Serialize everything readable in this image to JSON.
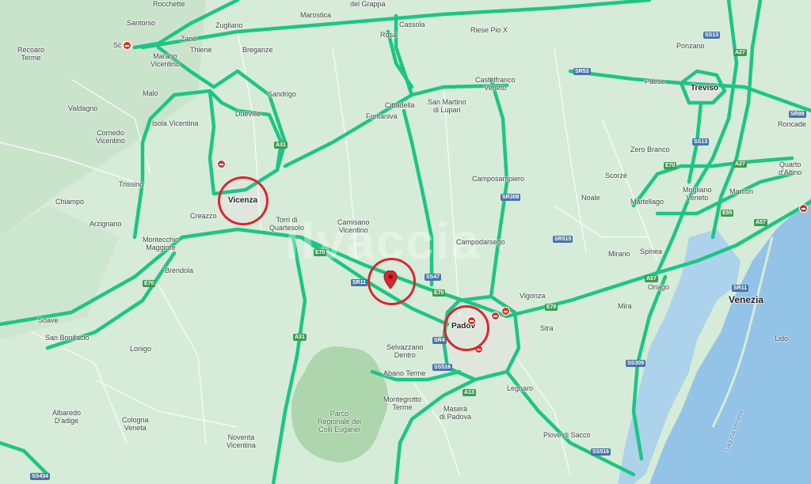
{
  "map": {
    "cities": [
      {
        "id": "rocchette",
        "name": "Rocchette"
      },
      {
        "id": "santorso",
        "name": "Santorso"
      },
      {
        "id": "schio",
        "name": "Sc"
      },
      {
        "id": "recoaro",
        "name": "Recoaro\nTerme"
      },
      {
        "id": "zane",
        "name": "Zanè"
      },
      {
        "id": "zugliano",
        "name": "Zugliano"
      },
      {
        "id": "marostica",
        "name": "Marostica"
      },
      {
        "id": "bassano",
        "name": "del Grappa"
      },
      {
        "id": "cassola",
        "name": "Cassola"
      },
      {
        "id": "rosa",
        "name": "Rosà"
      },
      {
        "id": "riese",
        "name": "Riese Pio X"
      },
      {
        "id": "marano",
        "name": "Marano\nVicentino"
      },
      {
        "id": "thiene",
        "name": "Thiene"
      },
      {
        "id": "breganze",
        "name": "Breganze"
      },
      {
        "id": "malo",
        "name": "Malo"
      },
      {
        "id": "valdagno",
        "name": "Valdagno"
      },
      {
        "id": "sandrigo",
        "name": "Sandrigo"
      },
      {
        "id": "cittadella",
        "name": "Cittadella"
      },
      {
        "id": "sanmartino",
        "name": "San Martino\ndi Lupari"
      },
      {
        "id": "castelfranco",
        "name": "Castelfranco\nVeneto"
      },
      {
        "id": "paese",
        "name": "Paese"
      },
      {
        "id": "ponzano",
        "name": "Ponzano"
      },
      {
        "id": "isola",
        "name": "Isola Vicentina"
      },
      {
        "id": "dueville",
        "name": "Dueville"
      },
      {
        "id": "fontaniva",
        "name": "Fontaniva"
      },
      {
        "id": "cornedo",
        "name": "Cornedo\nVicentino"
      },
      {
        "id": "trissino",
        "name": "Trissino"
      },
      {
        "id": "vicenza",
        "name": "Vicenza",
        "big": true
      },
      {
        "id": "chiampo",
        "name": "Chiampo"
      },
      {
        "id": "arzignano",
        "name": "Arzignano"
      },
      {
        "id": "creazzo",
        "name": "Creazzo"
      },
      {
        "id": "torri",
        "name": "Torri di\nQuartesolo"
      },
      {
        "id": "camisano",
        "name": "Camisano\nVicentino"
      },
      {
        "id": "camposampiero",
        "name": "Camposampiero"
      },
      {
        "id": "noale",
        "name": "Noale"
      },
      {
        "id": "scorze",
        "name": "Scorzè"
      },
      {
        "id": "zerobranco",
        "name": "Zero Branco"
      },
      {
        "id": "treviso",
        "name": "Treviso",
        "big": true
      },
      {
        "id": "roncade",
        "name": "Roncade"
      },
      {
        "id": "quarto",
        "name": "Quarto\nd'Altino"
      },
      {
        "id": "marcon",
        "name": "Marcon"
      },
      {
        "id": "mogliano",
        "name": "Mogliano\nVeneto"
      },
      {
        "id": "martellago",
        "name": "Martellago"
      },
      {
        "id": "montecchio",
        "name": "Montecchio\nMaggiore"
      },
      {
        "id": "brendola",
        "name": "Brendola"
      },
      {
        "id": "campodarsego",
        "name": "Campodarsego"
      },
      {
        "id": "mirano",
        "name": "Mirano"
      },
      {
        "id": "spinea",
        "name": "Spinea"
      },
      {
        "id": "vigonza",
        "name": "Vigonza"
      },
      {
        "id": "padova",
        "name": "Padov",
        "big": true
      },
      {
        "id": "mira",
        "name": "Mira"
      },
      {
        "id": "oriago",
        "name": "Oriago"
      },
      {
        "id": "venezia",
        "name": "Venezia",
        "venezia": true
      },
      {
        "id": "stra",
        "name": "Stra"
      },
      {
        "id": "soave",
        "name": "Soave"
      },
      {
        "id": "sanbonifacio",
        "name": "San Bonifacio"
      },
      {
        "id": "lonigo",
        "name": "Lonigo"
      },
      {
        "id": "selvazzano",
        "name": "Selvazzano\nDentro"
      },
      {
        "id": "abano",
        "name": "Abano Terme"
      },
      {
        "id": "lido",
        "name": "Lido"
      },
      {
        "id": "montegrotto",
        "name": "Montegrotto\nTerme"
      },
      {
        "id": "legnaro",
        "name": "Legnaro"
      },
      {
        "id": "albaredo",
        "name": "Albaredo\nD'adige"
      },
      {
        "id": "cologna",
        "name": "Cologna\nVeneta"
      },
      {
        "id": "masera",
        "name": "Maserà\ndi Padova"
      },
      {
        "id": "noventa",
        "name": "Noventa\nVicentina"
      },
      {
        "id": "piove",
        "name": "Piove di Sacco"
      }
    ],
    "park_label": "Parco\nRegionale dei\nColli Euganei",
    "laguna_label": "Laguna Veneta",
    "road_shields": [
      {
        "id": "ss13a",
        "text": "SS13",
        "color": "blue"
      },
      {
        "id": "a27a",
        "text": "A27",
        "color": "green"
      },
      {
        "id": "sr53",
        "text": "SR53",
        "color": "blue"
      },
      {
        "id": "sr89",
        "text": "SR89",
        "color": "blue"
      },
      {
        "id": "a31a",
        "text": "A31",
        "color": "green"
      },
      {
        "id": "ss13b",
        "text": "SS13",
        "color": "blue"
      },
      {
        "id": "e70a",
        "text": "E70",
        "color": "green"
      },
      {
        "id": "a27b",
        "text": "A27",
        "color": "green"
      },
      {
        "id": "e55",
        "text": "E55",
        "color": "green"
      },
      {
        "id": "a57a",
        "text": "A57",
        "color": "green"
      },
      {
        "id": "sr308",
        "text": "SR308",
        "color": "blue"
      },
      {
        "id": "sr515",
        "text": "SR515",
        "color": "blue"
      },
      {
        "id": "e70b",
        "text": "E70",
        "color": "green"
      },
      {
        "id": "sr11a",
        "text": "SR11",
        "color": "blue"
      },
      {
        "id": "ss47",
        "text": "SS47",
        "color": "blue"
      },
      {
        "id": "e70c",
        "text": "E70",
        "color": "green"
      },
      {
        "id": "a57b",
        "text": "A57",
        "color": "green"
      },
      {
        "id": "e70d",
        "text": "E70",
        "color": "green"
      },
      {
        "id": "sr11b",
        "text": "SR11",
        "color": "blue"
      },
      {
        "id": "e70e",
        "text": "E70",
        "color": "green"
      },
      {
        "id": "sr4",
        "text": "SR4",
        "color": "blue"
      },
      {
        "id": "a31b",
        "text": "A31",
        "color": "green"
      },
      {
        "id": "ss516a",
        "text": "SS516",
        "color": "blue"
      },
      {
        "id": "a13",
        "text": "A13",
        "color": "green"
      },
      {
        "id": "ss309",
        "text": "SS309",
        "color": "blue"
      },
      {
        "id": "ss516b",
        "text": "SS516",
        "color": "blue"
      },
      {
        "id": "ss434",
        "text": "SS434",
        "color": "blue"
      }
    ],
    "watermark": "ilvaccia",
    "colors": {
      "land": "#cfe8d4",
      "water": "#94c3e8",
      "traffic": "#1dc584",
      "marker": "#d7282f"
    }
  }
}
